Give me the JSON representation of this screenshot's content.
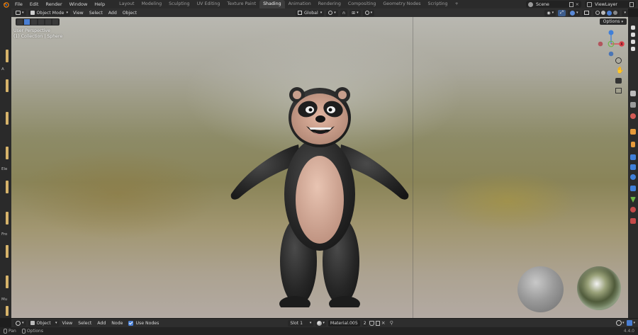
{
  "topbar": {
    "menus": [
      "File",
      "Edit",
      "Render",
      "Window",
      "Help"
    ],
    "workspaces": [
      "Layout",
      "Modeling",
      "Sculpting",
      "UV Editing",
      "Texture Paint",
      "Shading",
      "Animation",
      "Rendering",
      "Compositing",
      "Geometry Nodes",
      "Scripting"
    ],
    "active_workspace": "Shading",
    "add_tab": "+",
    "scene": "Scene",
    "view_layer": "ViewLayer"
  },
  "view_header": {
    "mode": "Object Mode",
    "menus": [
      "View",
      "Select",
      "Add",
      "Object"
    ],
    "transform_orientation": "Global",
    "options_label": "Options"
  },
  "viewport": {
    "view_name": "User Perspective",
    "collection_label": "(1) Collection | Sphere"
  },
  "left_strip": {
    "labels": [
      "Ele",
      "Fro",
      "Mu"
    ]
  },
  "node_header": {
    "editor_type": "Object",
    "menus": [
      "View",
      "Select",
      "Add",
      "Node"
    ],
    "use_nodes_label": "Use Nodes",
    "slot": "Slot 1",
    "material": "Material.005",
    "user_count": "2"
  },
  "statusbar": {
    "pan_label": "Pan",
    "options_label": "Options",
    "version": "4.4.0"
  },
  "colors": {
    "accent_blue": "#4a7fd4",
    "axis_x": "#e0424b",
    "axis_y": "#6bb547",
    "axis_z": "#3f7fd9",
    "topbar": "#2b2b2b"
  }
}
